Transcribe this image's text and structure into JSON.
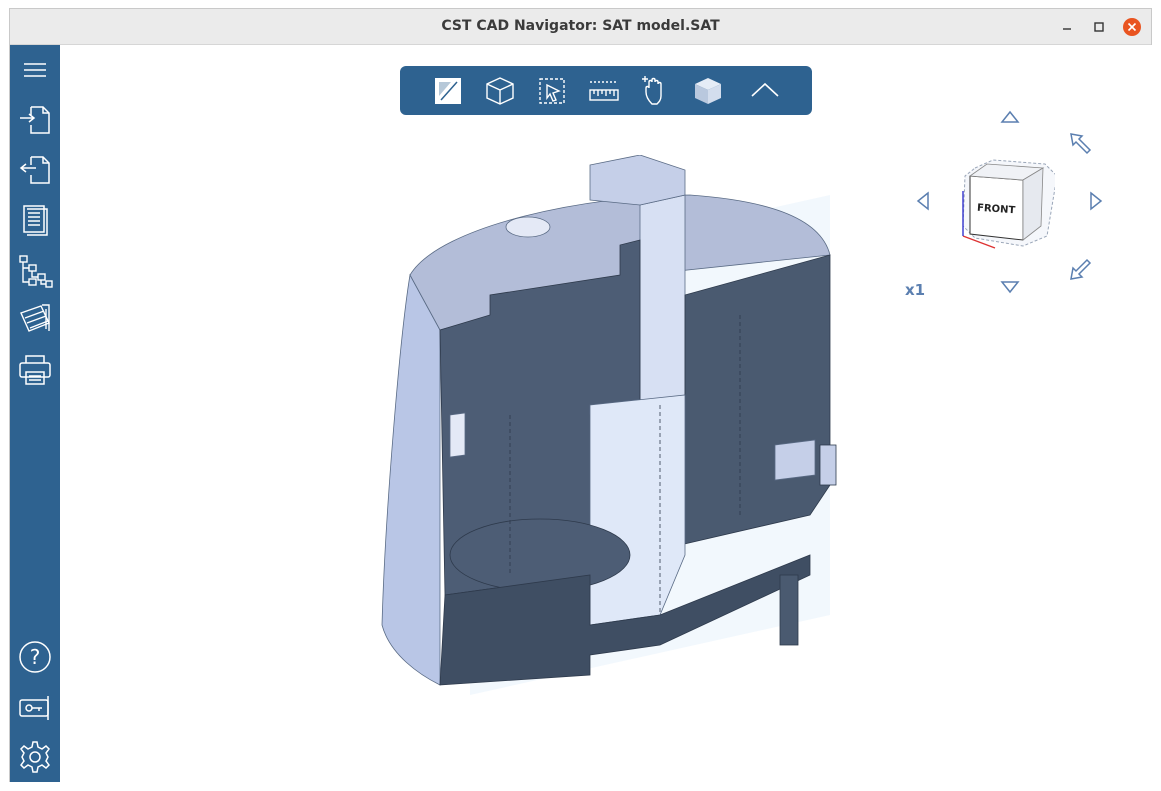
{
  "window": {
    "title": "CST CAD Navigator: SAT model.SAT"
  },
  "sidebar": {
    "items": [
      {
        "name": "menu-icon"
      },
      {
        "name": "import-icon"
      },
      {
        "name": "export-icon"
      },
      {
        "name": "document-icon"
      },
      {
        "name": "tree-icon"
      },
      {
        "name": "measure-sheet-icon"
      },
      {
        "name": "print-icon"
      }
    ],
    "bottom_items": [
      {
        "name": "help-icon"
      },
      {
        "name": "license-key-icon"
      },
      {
        "name": "settings-icon"
      }
    ]
  },
  "toolbar": {
    "items": [
      {
        "name": "section-plane-icon"
      },
      {
        "name": "wireframe-cube-icon"
      },
      {
        "name": "select-pointer-icon"
      },
      {
        "name": "ruler-icon"
      },
      {
        "name": "pan-hand-icon"
      },
      {
        "name": "solid-cube-icon"
      },
      {
        "name": "collapse-chevron-icon"
      }
    ]
  },
  "navcube": {
    "face_label": "FRONT",
    "zoom_label": "x1"
  },
  "colors": {
    "accent": "#2e6290",
    "nav_arrow": "#5b7fb0",
    "model_light": "#c7d3ec",
    "model_dark": "#4a5a70"
  }
}
